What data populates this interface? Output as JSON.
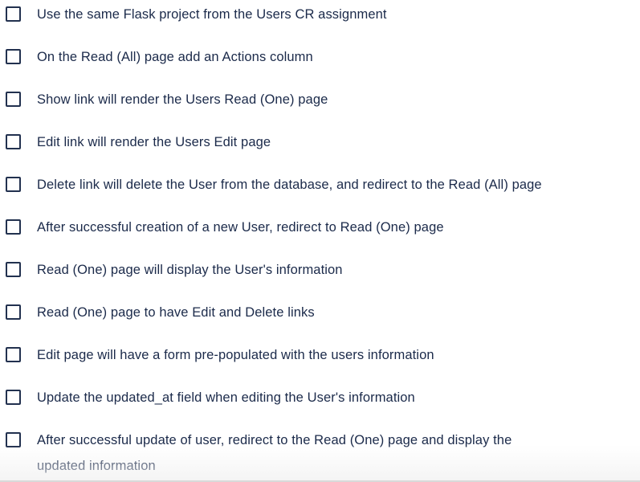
{
  "checklist": {
    "items": [
      {
        "label": "Use the same Flask project from the Users CR assignment"
      },
      {
        "label": "On the Read (All) page add an Actions column"
      },
      {
        "label": "Show link will render the Users Read (One) page"
      },
      {
        "label": "Edit link will render the Users Edit page"
      },
      {
        "label": "Delete link will delete the User from the database, and redirect to the Read (All) page"
      },
      {
        "label": "After successful creation of a new User, redirect to Read (One) page"
      },
      {
        "label": "Read (One) page will display the User's information"
      },
      {
        "label": "Read (One) page to have Edit and Delete links"
      },
      {
        "label": "Edit page will have a form pre-populated with the users information"
      },
      {
        "label": "Update the updated_at field when editing the User's information"
      },
      {
        "label": "After successful update of user, redirect to the Read (One) page and display the updated information"
      }
    ]
  }
}
